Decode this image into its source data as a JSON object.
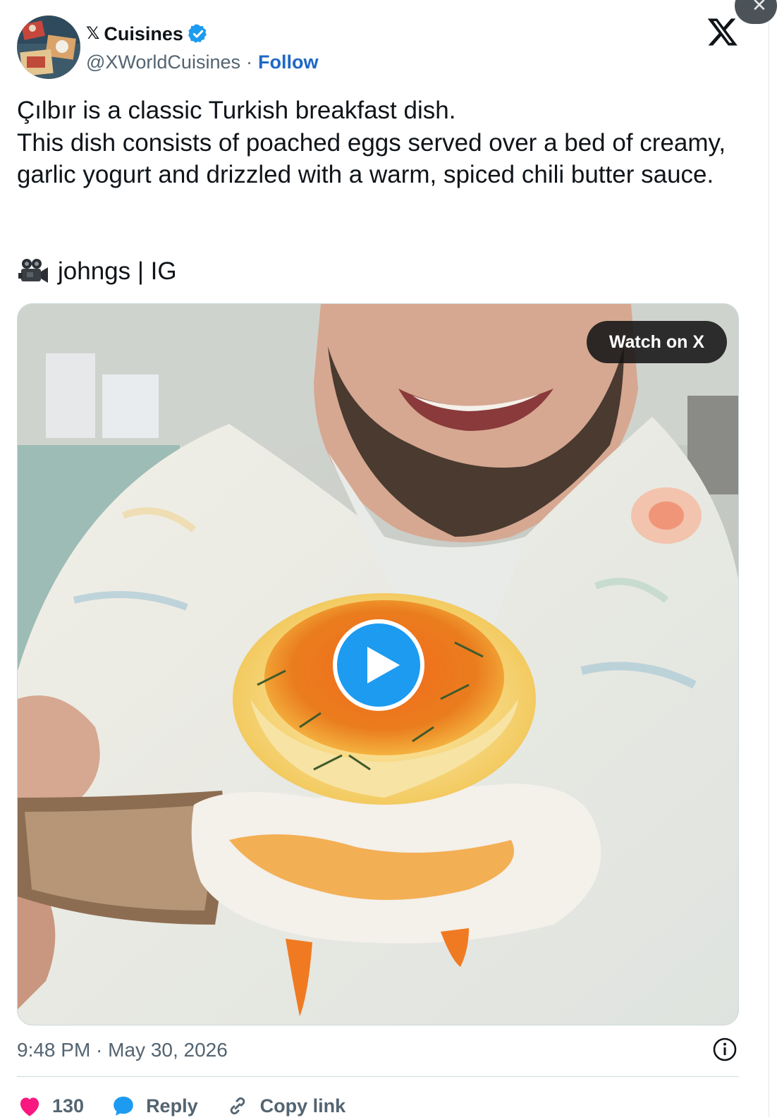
{
  "post": {
    "author_name": "Cuisines",
    "author_prefix": "𝕏",
    "handle": "@XWorldCuisines",
    "separator": "·",
    "follow_label": "Follow",
    "text_lines": [
      "Çılbır is a classic Turkish breakfast dish.",
      "This dish consists of poached eggs served over a bed of creamy, garlic yogurt and drizzled with a warm, spiced chili butter sauce."
    ],
    "credit": "johngs | IG",
    "timestamp": "9:48 PM · May 30, 2026"
  },
  "media": {
    "watch_label": "Watch on X",
    "play_icon": "play-icon"
  },
  "actions": {
    "like_count": "130",
    "reply_label": "Reply",
    "copy_label": "Copy link"
  },
  "colors": {
    "accent": "#1d9bf0",
    "follow": "#1d68c6",
    "like": "#f91880",
    "muted": "#536471"
  }
}
